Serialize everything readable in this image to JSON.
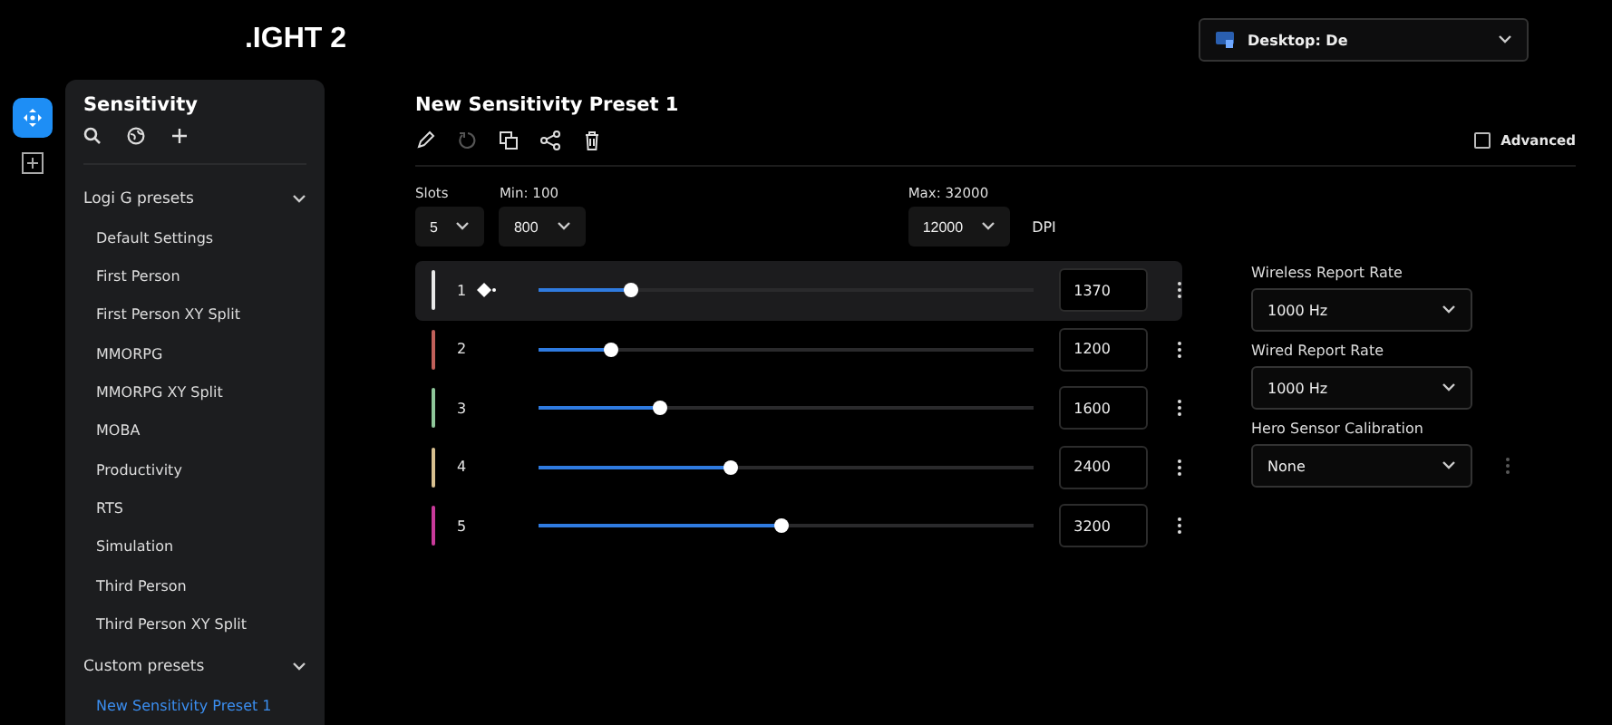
{
  "header": {
    "title": ".IGHT 2",
    "device": "Desktop: De"
  },
  "sidebar": {
    "title": "Sensitivity",
    "groups": [
      {
        "label": "Logi G presets",
        "expanded": true,
        "items": [
          {
            "label": "Default Settings",
            "selected": false
          },
          {
            "label": "First Person",
            "selected": false
          },
          {
            "label": "First Person XY Split",
            "selected": false
          },
          {
            "label": "MMORPG",
            "selected": false
          },
          {
            "label": "MMORPG XY Split",
            "selected": false
          },
          {
            "label": "MOBA",
            "selected": false
          },
          {
            "label": "Productivity",
            "selected": false
          },
          {
            "label": "RTS",
            "selected": false
          },
          {
            "label": "Simulation",
            "selected": false
          },
          {
            "label": "Third Person",
            "selected": false
          },
          {
            "label": "Third Person XY Split",
            "selected": false
          }
        ]
      },
      {
        "label": "Custom presets",
        "expanded": true,
        "items": [
          {
            "label": "New Sensitivity Preset 1",
            "selected": true
          }
        ]
      }
    ]
  },
  "preset": {
    "title": "New Sensitivity Preset 1",
    "advanced": {
      "label": "Advanced",
      "checked": false
    },
    "slots": {
      "label": "Slots",
      "value": "5"
    },
    "min": {
      "label": "Min: 100",
      "value": "800"
    },
    "max": {
      "label": "Max: 32000",
      "value": "12000"
    },
    "unit": "DPI",
    "rows": [
      {
        "number": "1",
        "value": "1370",
        "level": 0.186,
        "color": "#e8e8e8",
        "selected": true,
        "is_default": true
      },
      {
        "number": "2",
        "value": "1200",
        "level": 0.146,
        "color": "#c0605a",
        "selected": false,
        "is_default": false
      },
      {
        "number": "3",
        "value": "1600",
        "level": 0.245,
        "color": "#8fc79a",
        "selected": false,
        "is_default": false
      },
      {
        "number": "4",
        "value": "2400",
        "level": 0.39,
        "color": "#d8c090",
        "selected": false,
        "is_default": false
      },
      {
        "number": "5",
        "value": "3200",
        "level": 0.49,
        "color": "#c83a9a",
        "selected": false,
        "is_default": false
      }
    ]
  },
  "settings": [
    {
      "label": "Wireless Report Rate",
      "value": "1000 Hz"
    },
    {
      "label": "Wired Report Rate",
      "value": "1000 Hz"
    },
    {
      "label": "Hero Sensor Calibration",
      "value": "None"
    }
  ]
}
